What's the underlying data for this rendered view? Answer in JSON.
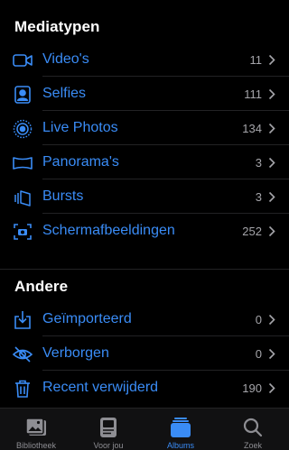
{
  "sections": [
    {
      "title": "Mediatypen",
      "items": [
        {
          "label": "Video's",
          "count": "11",
          "icon": "video-icon"
        },
        {
          "label": "Selfies",
          "count": "111",
          "icon": "selfie-icon"
        },
        {
          "label": "Live Photos",
          "count": "134",
          "icon": "live-photo-icon"
        },
        {
          "label": "Panorama's",
          "count": "3",
          "icon": "panorama-icon"
        },
        {
          "label": "Bursts",
          "count": "3",
          "icon": "burst-icon"
        },
        {
          "label": "Schermafbeeldingen",
          "count": "252",
          "icon": "screenshot-icon"
        }
      ]
    },
    {
      "title": "Andere",
      "items": [
        {
          "label": "Geïmporteerd",
          "count": "0",
          "icon": "import-icon"
        },
        {
          "label": "Verborgen",
          "count": "0",
          "icon": "hidden-eye-icon"
        },
        {
          "label": "Recent verwijderd",
          "count": "190",
          "icon": "trash-icon"
        }
      ]
    }
  ],
  "tabbar": {
    "tabs": [
      {
        "label": "Bibliotheek",
        "icon": "library-icon",
        "active": false
      },
      {
        "label": "Voor jou",
        "icon": "for-you-icon",
        "active": false
      },
      {
        "label": "Albums",
        "icon": "albums-icon",
        "active": true
      },
      {
        "label": "Zoek",
        "icon": "search-icon",
        "active": false
      }
    ]
  },
  "colors": {
    "accent": "#3a8cf6",
    "background": "#000000",
    "count": "#a5a5aa",
    "inactive_tab": "#8e8e93"
  }
}
